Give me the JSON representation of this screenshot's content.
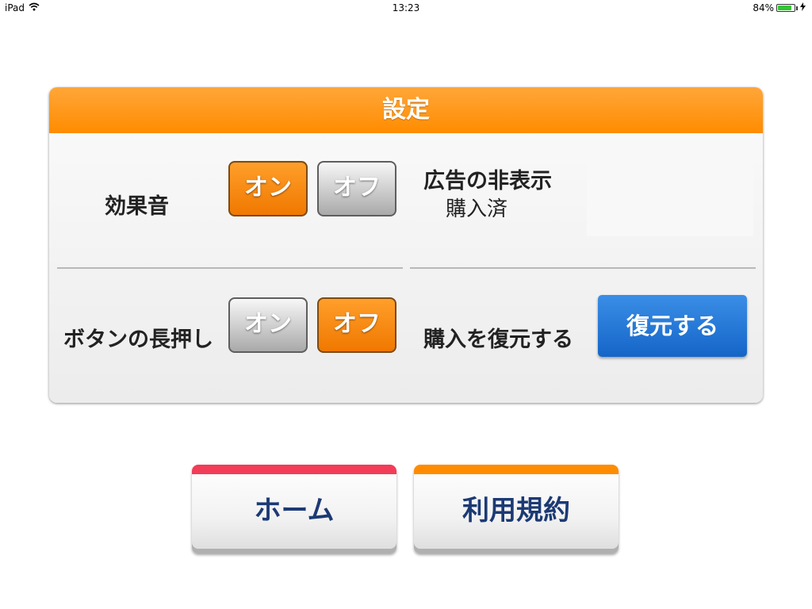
{
  "status_bar": {
    "device": "iPad",
    "time": "13:23",
    "battery_text": "84%",
    "battery_level": 0.84
  },
  "settings": {
    "title": "設定",
    "sound_effects": {
      "label": "効果音",
      "on_label": "オン",
      "off_label": "オフ",
      "selected": "on"
    },
    "long_press": {
      "label": "ボタンの長押し",
      "on_label": "オン",
      "off_label": "オフ",
      "selected": "off"
    },
    "hide_ads": {
      "label": "広告の非表示",
      "status": "購入済"
    },
    "restore": {
      "label": "購入を復元する",
      "button_label": "復元する"
    }
  },
  "bottom_buttons": {
    "home_label": "ホーム",
    "terms_label": "利用規約"
  },
  "colors": {
    "header": "#ff8c00",
    "selected_toggle": "#f07800",
    "restore_button": "#1e74d4",
    "home_stripe": "#f23c58",
    "terms_stripe": "#ff8c00",
    "bottom_text": "#1c3a74"
  }
}
